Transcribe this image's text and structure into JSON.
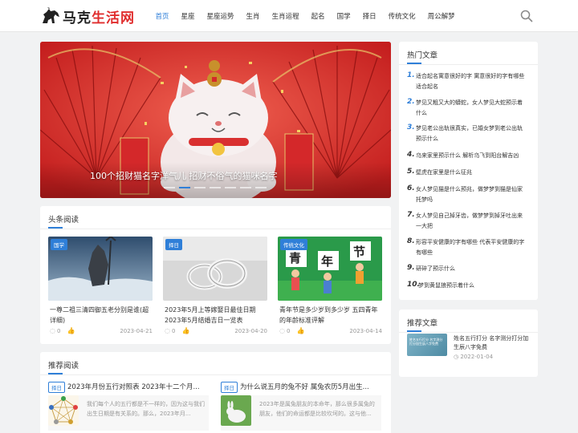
{
  "site": {
    "logo_part1": "马克",
    "logo_part2": "生活网"
  },
  "nav": [
    "首页",
    "星座",
    "星座运势",
    "生肖",
    "生肖运程",
    "起名",
    "国学",
    "择日",
    "传统文化",
    "周公解梦"
  ],
  "slider": {
    "caption": "100个招财猫名字洋气儿 招财不俗气的猫咪名字",
    "dots": 7,
    "active_dot": 2
  },
  "headlines": {
    "title": "头条阅读",
    "items": [
      {
        "tag": "国学",
        "title": "一尊二祖三清四御五老分别是谁(超详细)",
        "views": "0",
        "likes": "0",
        "date": "2023-04-21"
      },
      {
        "tag": "择日",
        "title": "2023年5月上等嫁娶日最佳日期 2023年5月结婚吉日一览表",
        "views": "0",
        "likes": "0",
        "date": "2023-04-20"
      },
      {
        "tag": "传统文化",
        "title": "青年节是多少岁到多少岁 五四青年的年龄标准评解",
        "views": "0",
        "likes": "0",
        "date": "2023-04-14"
      }
    ]
  },
  "recommended": {
    "title": "推荐阅读",
    "items": [
      {
        "tag": "择日",
        "title": "2023年月份五行对照表 2023年十二个月...",
        "excerpt": "我们每个人的五行都是不一样的，因为这与我们出生日期是有关系的。那么，2023年月..."
      },
      {
        "tag": "择日",
        "title": "为什么说五月的兔不好 属兔农历5月出生...",
        "excerpt": "2023年是属兔朋友的本命年，那么很多属兔的朋友，他们的命运都是比较坎坷的。这与他..."
      }
    ]
  },
  "hot": {
    "title": "热门文章",
    "items": [
      {
        "num": "1.",
        "text": "适合起名寓意很好的字 寓意很好的字有哪些适合起名"
      },
      {
        "num": "2.",
        "text": "梦见又粗又大的蟒蛇，女人梦见大蛇预示着什么"
      },
      {
        "num": "3.",
        "text": "梦见老公出轨很真实，已婚女梦到老公出轨预示什么"
      },
      {
        "num": "4.",
        "text": "乌来家里预示什么 解析乌飞到阳台解吉凶"
      },
      {
        "num": "5.",
        "text": "壁虎在家里是什么征兆"
      },
      {
        "num": "6.",
        "text": "女人梦见猫是什么预兆，做梦梦到猫是仙家托梦吗"
      },
      {
        "num": "7.",
        "text": "女人梦见自己掉牙齿，做梦梦到掉牙吐出来一大把"
      },
      {
        "num": "8.",
        "text": "形容平安健康的字有哪些 代表平安健康的字有哪些"
      },
      {
        "num": "9.",
        "text": "研碎了预示什么"
      },
      {
        "num": "10.",
        "text": "梦到黄鼠狼预示着什么"
      }
    ]
  },
  "recommended_side": {
    "title": "推荐文章",
    "thumb_text": "姓名五行打分 名字测分打分加生辰八字免费",
    "item_title": "姓名五行打分 名字测分打分加生辰八字免费",
    "date": "2022-01-04"
  },
  "colors": {
    "accent": "#2f7fd8",
    "brand_red": "#e02d2d",
    "bg": "#f1f2f3"
  }
}
